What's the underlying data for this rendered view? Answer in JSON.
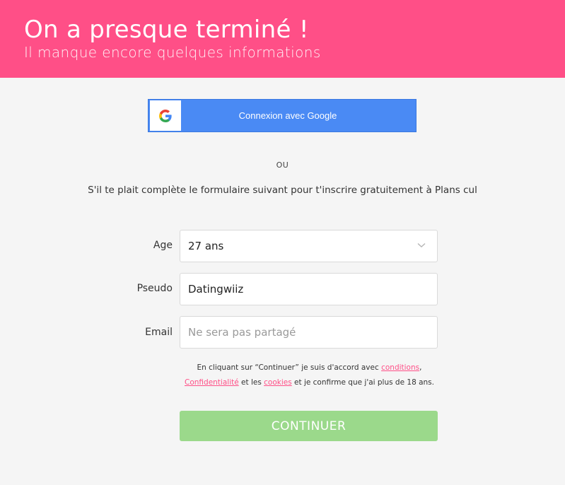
{
  "header": {
    "title": "On a presque terminé !",
    "subtitle": "Il manque encore quelques informations",
    "background_color": "#ff4f87"
  },
  "google_button": {
    "label": "Connexion avec Google",
    "icon": "google-g-icon",
    "color": "#4a8af4"
  },
  "separator": "OU",
  "intro_text": "S'il te plait complète le formulaire suivant pour t'inscrire gratuitement à Plans cul",
  "form": {
    "age": {
      "label": "Age",
      "value": "27 ans",
      "icon": "chevron-down-icon"
    },
    "pseudo": {
      "label": "Pseudo",
      "value": "Datingwiiz"
    },
    "email": {
      "label": "Email",
      "value": "",
      "placeholder": "Ne sera pas partagé"
    }
  },
  "terms": {
    "part1": "En cliquant sur “Continuer” je suis d'accord avec ",
    "link_conditions": "conditions",
    "part2": ",",
    "link_privacy": "Confidentialité",
    "part3": " et les ",
    "link_cookies": "cookies",
    "part4": " et je confirme que j'ai plus de 18 ans.",
    "link_color": "#ff4f87"
  },
  "continue_button": {
    "label": "CONTINUER",
    "color": "#9bd98b"
  }
}
